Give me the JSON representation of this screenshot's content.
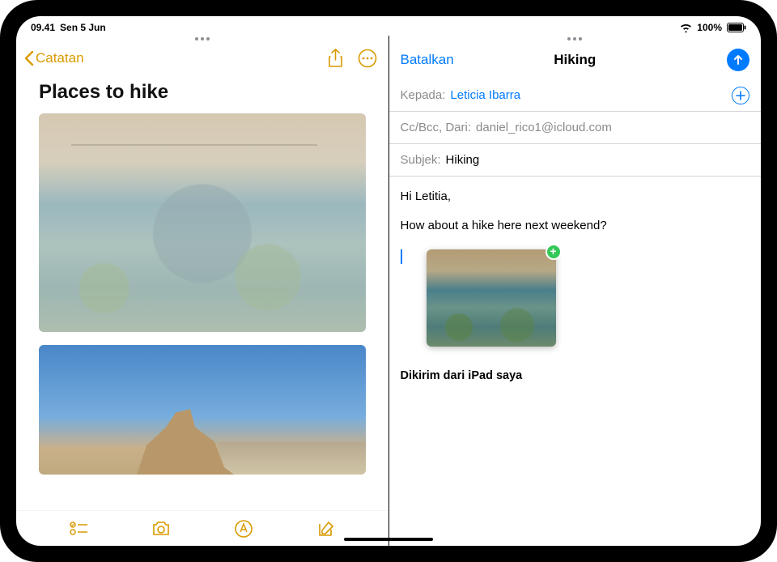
{
  "status": {
    "time": "09.41",
    "date": "Sen 5 Jun",
    "battery_pct": "100%"
  },
  "notes": {
    "back_label": "Catatan",
    "title": "Places to hike"
  },
  "mail": {
    "cancel_label": "Batalkan",
    "title": "Hiking",
    "to_label": "Kepada:",
    "to_value": "Leticia Ibarra",
    "ccbcc_label": "Cc/Bcc, Dari:",
    "ccbcc_value": "daniel_rico1@icloud.com",
    "subject_label": "Subjek:",
    "subject_value": "Hiking",
    "body_line1": "Hi Letitia,",
    "body_line2": "How about a hike here next weekend?",
    "signature": "Dikirim dari iPad saya",
    "add_badge": "+"
  }
}
